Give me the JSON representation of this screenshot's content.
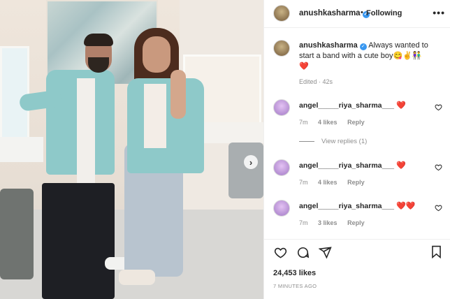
{
  "post": {
    "username": "anushkasharma",
    "follow_separator": "•",
    "follow_label": "Following",
    "more_label": "•••",
    "carousel_next": "›"
  },
  "caption": {
    "username": "anushkasharma",
    "text": "Always wanted to start a band with a cute boy😋✌️👫",
    "heart": "❤️",
    "meta": "Edited · 42s"
  },
  "comments": [
    {
      "username": "angel_____riya_sharma___",
      "text": "❤️",
      "time": "7m",
      "likes": "4 likes",
      "reply": "Reply"
    },
    {
      "username": "angel_____riya_sharma___",
      "text": "❤️",
      "time": "7m",
      "likes": "4 likes",
      "reply": "Reply"
    },
    {
      "username": "angel_____riya_sharma___",
      "text": "❤️❤️",
      "time": "7m",
      "likes": "3 likes",
      "reply": "Reply"
    }
  ],
  "view_replies": "View replies (1)",
  "footer": {
    "likes": "24,453 likes",
    "time_ago": "7 MINUTES AGO"
  },
  "icons": [
    "heart-outline-icon",
    "comment-icon",
    "share-icon",
    "bookmark-icon",
    "chevron-right-icon",
    "verified-badge-icon",
    "more-options-icon"
  ],
  "colors": {
    "verified": "#3897f0",
    "heart": "#ed1c24",
    "muted": "#8e8e8e",
    "text": "#262626"
  }
}
